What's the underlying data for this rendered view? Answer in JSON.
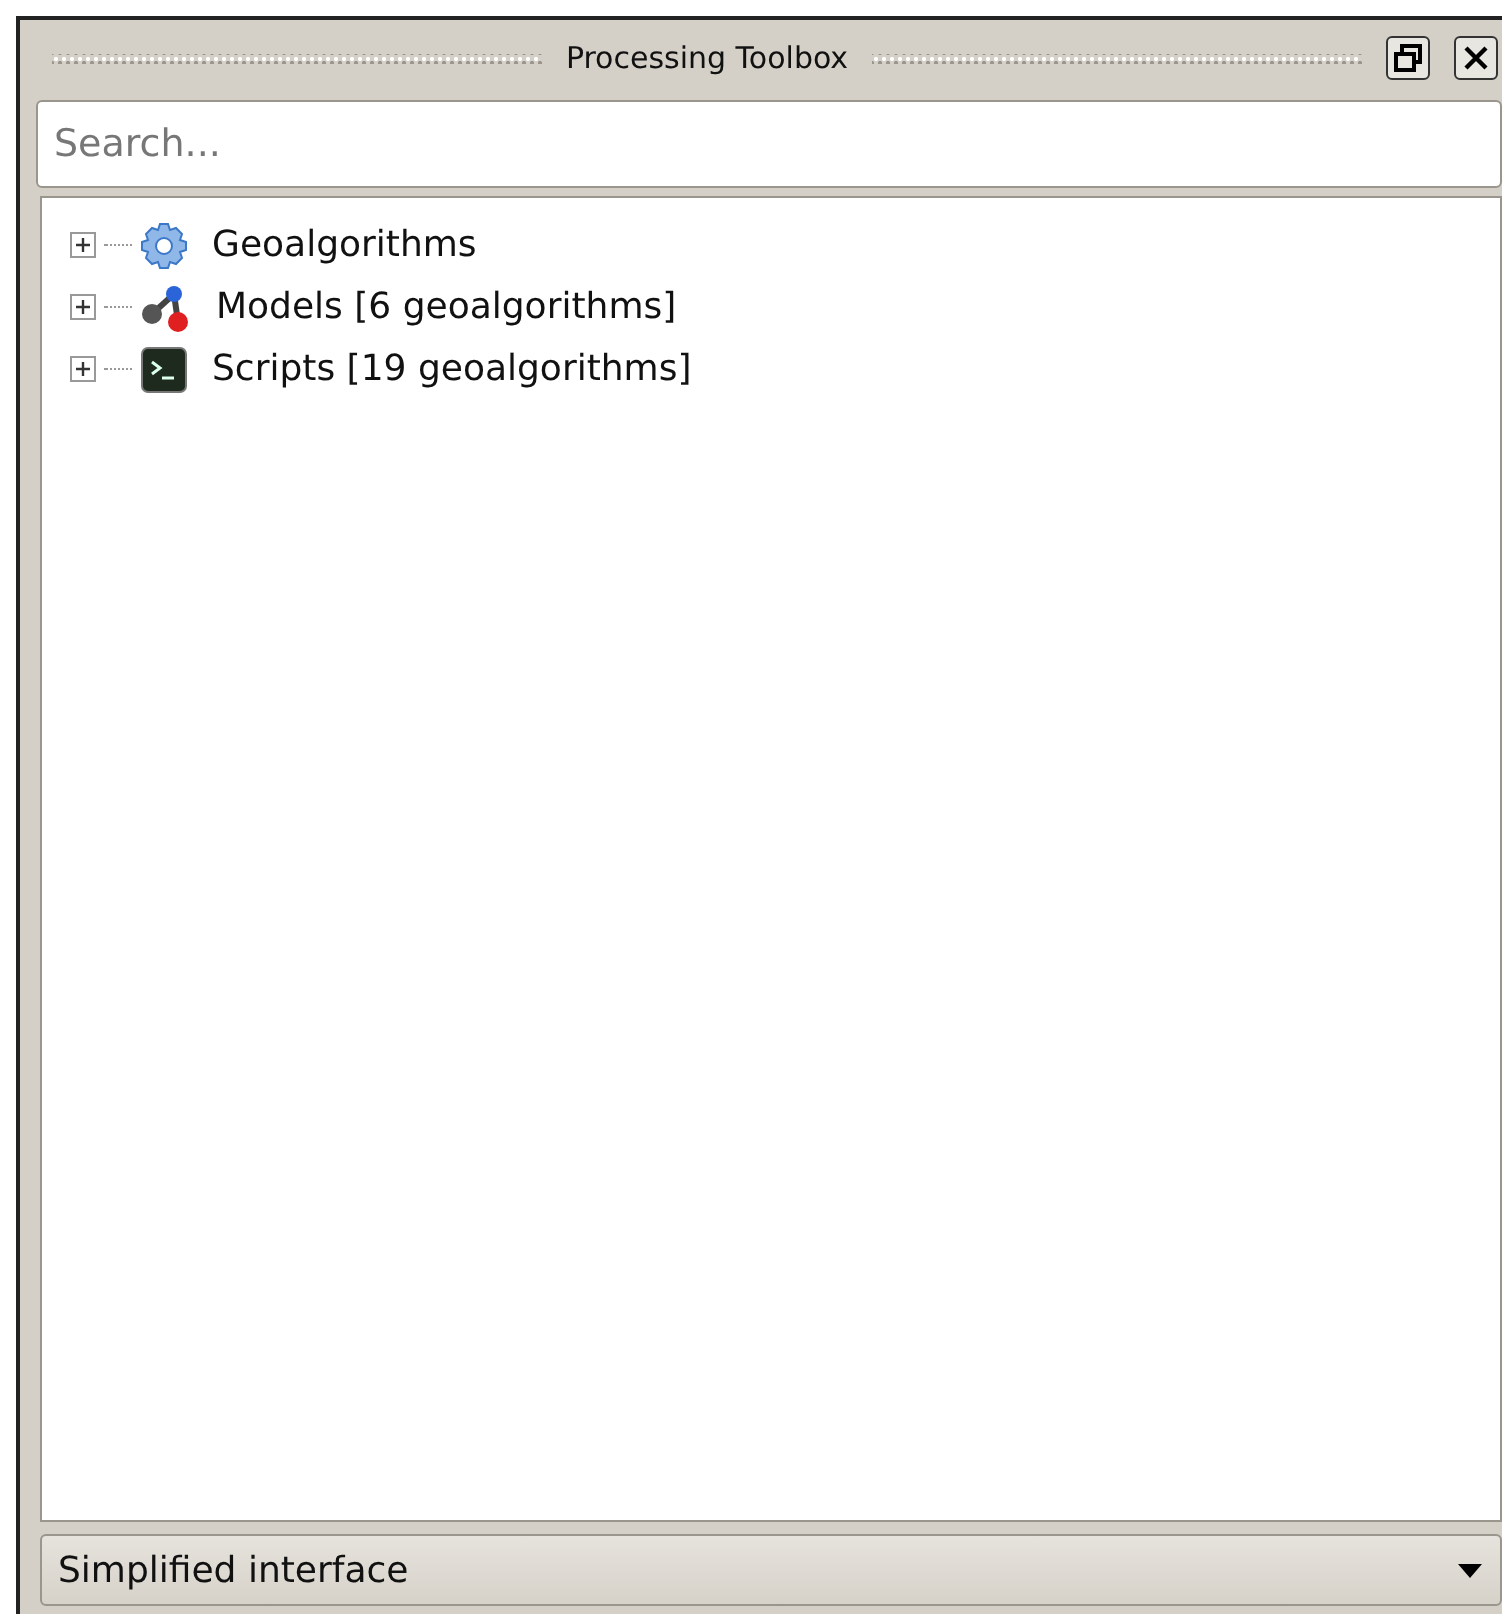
{
  "window": {
    "title": "Processing Toolbox"
  },
  "search": {
    "placeholder": "Search..."
  },
  "tree": [
    {
      "label": "Geoalgorithms",
      "kind": "gear",
      "expanded": false
    },
    {
      "label": "Models [6 geoalgorithms]",
      "kind": "model",
      "expanded": false
    },
    {
      "label": "Scripts [19 geoalgorithms]",
      "kind": "script",
      "expanded": false
    }
  ],
  "mode": {
    "value": "Simplified interface"
  }
}
